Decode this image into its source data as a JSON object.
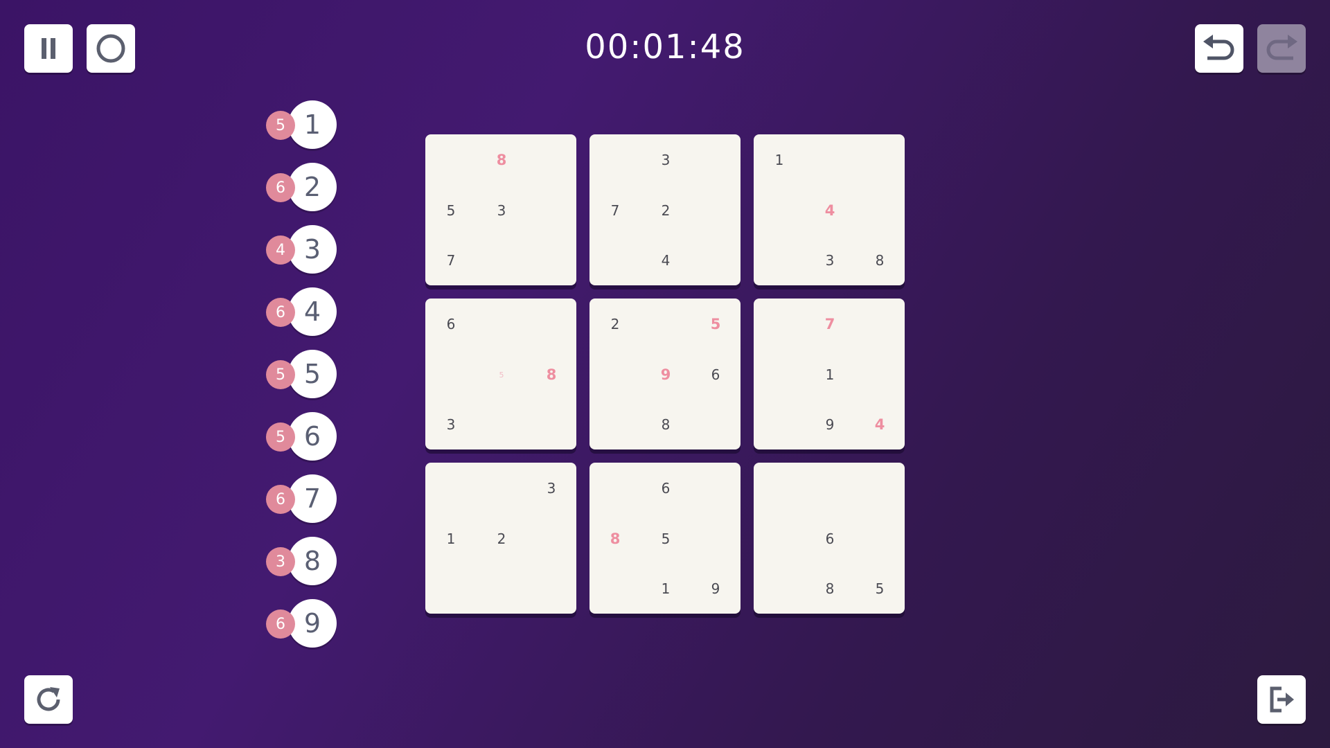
{
  "timer": "00:01:48",
  "toolbar": {
    "pause_icon": "pause-icon",
    "hint_icon": "circle-icon",
    "undo_icon": "undo-icon",
    "redo_icon": "redo-icon",
    "restart_icon": "restart-icon",
    "exit_icon": "exit-icon"
  },
  "colors": {
    "given": "#4a4a52",
    "user": "#ee8ea0",
    "count_badge": "#e08a9b"
  },
  "numbers": [
    {
      "digit": "1",
      "count": "5"
    },
    {
      "digit": "2",
      "count": "6"
    },
    {
      "digit": "3",
      "count": "4"
    },
    {
      "digit": "4",
      "count": "6"
    },
    {
      "digit": "5",
      "count": "5"
    },
    {
      "digit": "6",
      "count": "5"
    },
    {
      "digit": "7",
      "count": "6"
    },
    {
      "digit": "8",
      "count": "3"
    },
    {
      "digit": "9",
      "count": "6"
    }
  ],
  "grid": {
    "rows": [
      [
        "",
        "8",
        "",
        "",
        "3",
        "",
        "1",
        "",
        ""
      ],
      [
        "5",
        "3",
        "",
        "7",
        "2",
        "",
        "",
        "4",
        ""
      ],
      [
        "7",
        "",
        "",
        "",
        "4",
        "",
        "",
        "3",
        "8"
      ],
      [
        "6",
        "",
        "",
        "2",
        "",
        "5",
        "",
        "7",
        ""
      ],
      [
        "",
        "5",
        "8",
        "",
        "9",
        "6",
        "",
        "1",
        ""
      ],
      [
        "3",
        "",
        "",
        "",
        "8",
        "",
        "",
        "9",
        "4"
      ],
      [
        "",
        "",
        "3",
        "",
        "6",
        "",
        "",
        "",
        ""
      ],
      [
        "1",
        "2",
        "",
        "8",
        "5",
        "",
        "",
        "6",
        ""
      ],
      [
        "",
        "",
        "",
        "",
        "1",
        "9",
        "",
        "8",
        "5"
      ]
    ],
    "kinds": [
      [
        "",
        "user",
        "",
        "",
        "given",
        "",
        "given",
        "",
        ""
      ],
      [
        "given",
        "given",
        "",
        "given",
        "given",
        "",
        "",
        "user",
        ""
      ],
      [
        "given",
        "",
        "",
        "",
        "given",
        "",
        "",
        "given",
        "given"
      ],
      [
        "given",
        "",
        "",
        "given",
        "",
        "user",
        "",
        "user",
        ""
      ],
      [
        "",
        "note",
        "user",
        "",
        "user",
        "given",
        "",
        "given",
        ""
      ],
      [
        "given",
        "",
        "",
        "",
        "given",
        "",
        "",
        "given",
        "user"
      ],
      [
        "",
        "",
        "given",
        "",
        "given",
        "",
        "",
        "",
        ""
      ],
      [
        "given",
        "given",
        "",
        "user",
        "given",
        "",
        "",
        "given",
        ""
      ],
      [
        "",
        "",
        "",
        "",
        "given",
        "given",
        "",
        "given",
        "given"
      ]
    ]
  }
}
